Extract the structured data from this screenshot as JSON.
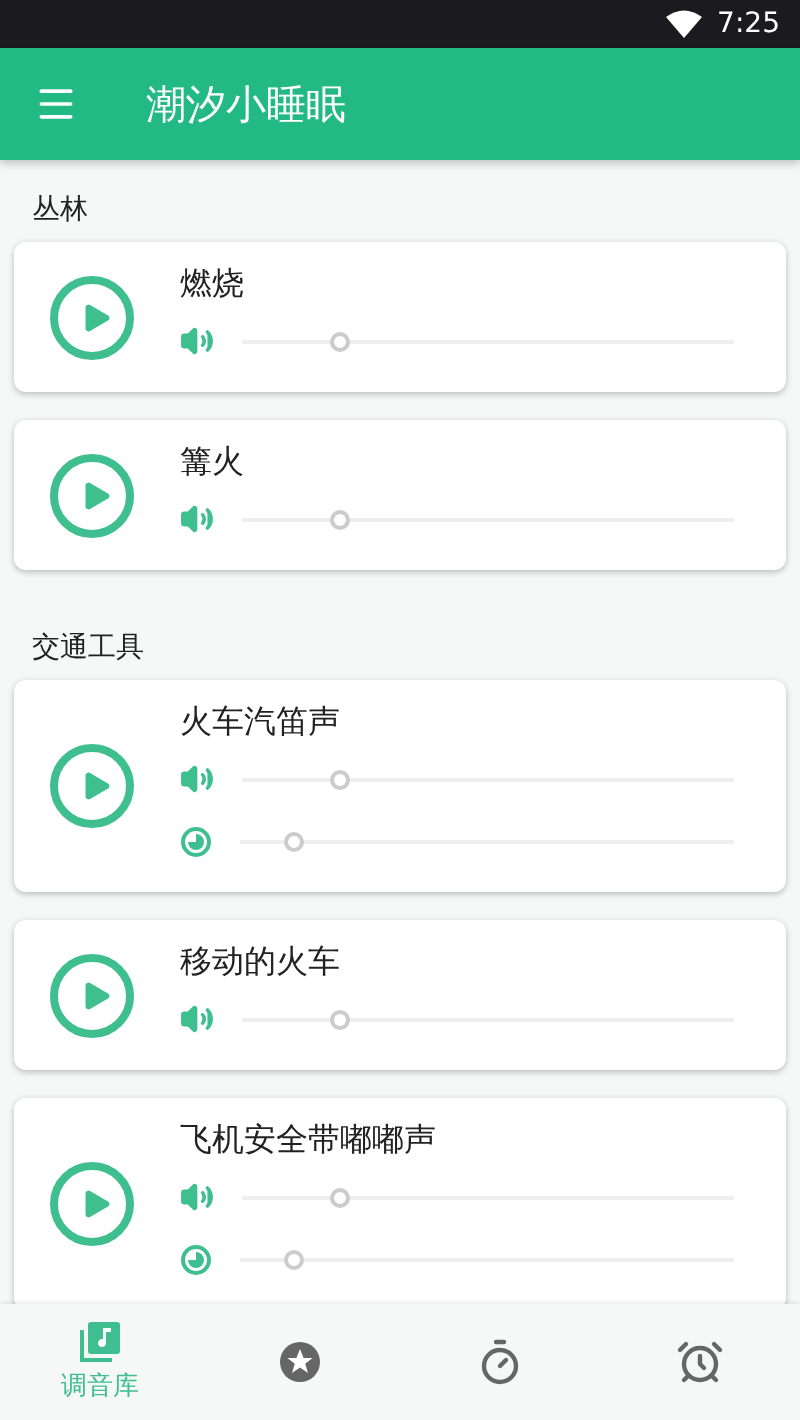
{
  "status_bar": {
    "time": "7:25"
  },
  "app_bar": {
    "title": "潮汐小睡眠"
  },
  "sections": [
    {
      "title": "丛林",
      "sounds": [
        {
          "name": "燃烧",
          "playing": false,
          "sliders": [
            {
              "kind": "volume",
              "level": 0.2
            }
          ]
        },
        {
          "name": "篝火",
          "playing": false,
          "sliders": [
            {
              "kind": "volume",
              "level": 0.2
            }
          ]
        }
      ]
    },
    {
      "title": "交通工具",
      "sounds": [
        {
          "name": "火车汽笛声",
          "playing": false,
          "sliders": [
            {
              "kind": "volume",
              "level": 0.2
            },
            {
              "kind": "timer",
              "level": 0.11
            }
          ]
        },
        {
          "name": "移动的火车",
          "playing": false,
          "sliders": [
            {
              "kind": "volume",
              "level": 0.2
            }
          ]
        },
        {
          "name": "飞机安全带嘟嘟声",
          "playing": false,
          "sliders": [
            {
              "kind": "volume",
              "level": 0.2
            },
            {
              "kind": "timer",
              "level": 0.11
            }
          ]
        }
      ]
    }
  ],
  "bottom_nav": [
    {
      "kind": "library",
      "label": "调音库",
      "selected": true
    },
    {
      "kind": "favorites",
      "selected": false
    },
    {
      "kind": "timer",
      "selected": false
    },
    {
      "kind": "alarm",
      "selected": false
    }
  ]
}
